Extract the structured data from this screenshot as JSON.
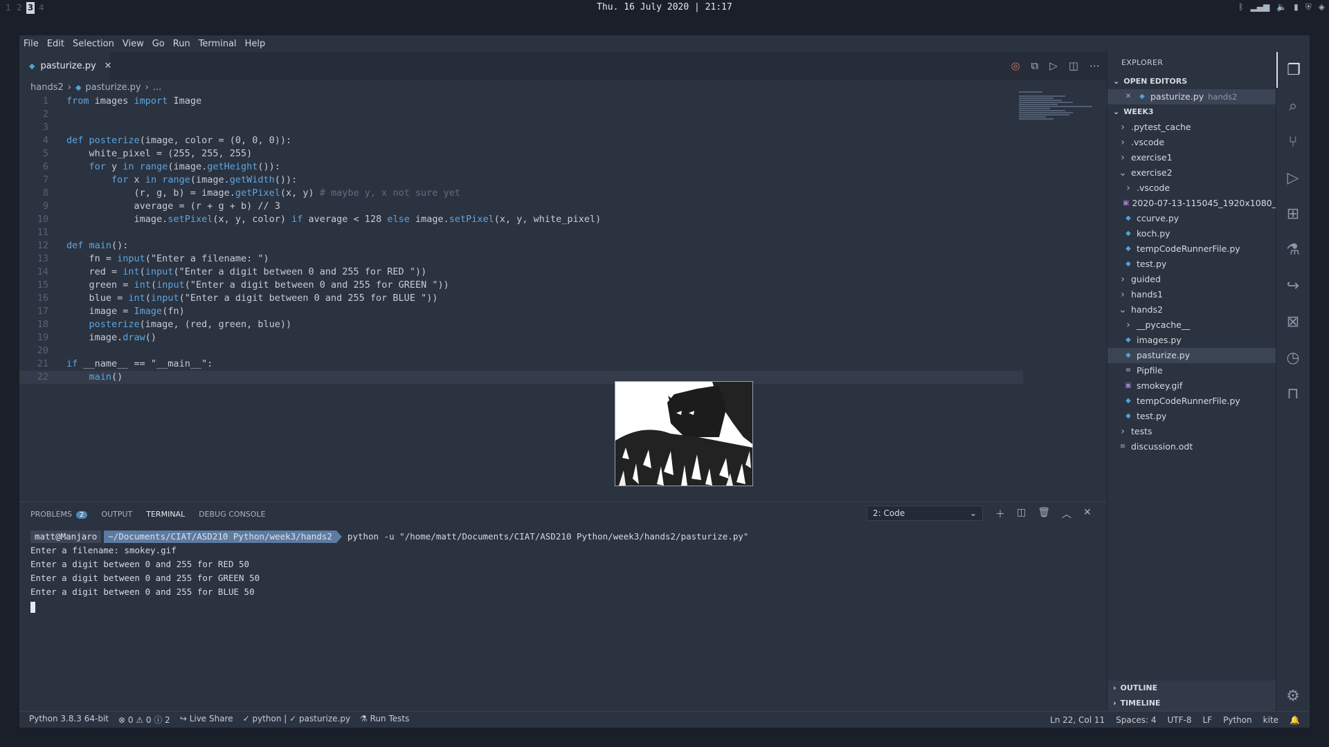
{
  "topbar": {
    "workspaces": [
      "1",
      "2",
      "3",
      "4"
    ],
    "active_workspace": "3",
    "datetime": "Thu. 16 July 2020  |  21:17"
  },
  "menu": [
    "File",
    "Edit",
    "Selection",
    "View",
    "Go",
    "Run",
    "Terminal",
    "Help"
  ],
  "editor": {
    "tab_label": "pasturize.py",
    "breadcrumb": [
      "hands2",
      "pasturize.py",
      "..."
    ],
    "lines": [
      {
        "n": "1",
        "parts": [
          [
            "kw",
            "from"
          ],
          [
            "",
            " images "
          ],
          [
            "kw",
            "import"
          ],
          [
            "",
            " Image"
          ]
        ]
      },
      {
        "n": "2",
        "parts": []
      },
      {
        "n": "3",
        "parts": []
      },
      {
        "n": "4",
        "parts": [
          [
            "kw",
            "def"
          ],
          [
            "",
            " "
          ],
          [
            "fn",
            "posterize"
          ],
          [
            "",
            "(image, color = (0, 0, 0)):"
          ]
        ]
      },
      {
        "n": "5",
        "parts": [
          [
            "",
            "    white_pixel = (255, 255, 255)"
          ]
        ]
      },
      {
        "n": "6",
        "parts": [
          [
            "",
            "    "
          ],
          [
            "kw",
            "for"
          ],
          [
            "",
            " y "
          ],
          [
            "kw",
            "in"
          ],
          [
            "",
            " "
          ],
          [
            "fn",
            "range"
          ],
          [
            "",
            "(image."
          ],
          [
            "fn",
            "getHeight"
          ],
          [
            "",
            "()):"
          ]
        ]
      },
      {
        "n": "7",
        "parts": [
          [
            "",
            "        "
          ],
          [
            "kw",
            "for"
          ],
          [
            "",
            " x "
          ],
          [
            "kw",
            "in"
          ],
          [
            "",
            " "
          ],
          [
            "fn",
            "range"
          ],
          [
            "",
            "(image."
          ],
          [
            "fn",
            "getWidth"
          ],
          [
            "",
            "()):"
          ]
        ]
      },
      {
        "n": "8",
        "parts": [
          [
            "",
            "            (r, g, b) = image."
          ],
          [
            "fn",
            "getPixel"
          ],
          [
            "",
            "(x, y) "
          ],
          [
            "cm",
            "# maybe y, x not sure yet"
          ]
        ]
      },
      {
        "n": "9",
        "parts": [
          [
            "",
            "            average = (r + g + b) // 3"
          ]
        ]
      },
      {
        "n": "10",
        "parts": [
          [
            "",
            "            image."
          ],
          [
            "fn",
            "setPixel"
          ],
          [
            "",
            "(x, y, color) "
          ],
          [
            "kw",
            "if"
          ],
          [
            "",
            " average < 128 "
          ],
          [
            "kw",
            "else"
          ],
          [
            "",
            " image."
          ],
          [
            "fn",
            "setPixel"
          ],
          [
            "",
            "(x, y, white_pixel)"
          ]
        ]
      },
      {
        "n": "11",
        "parts": []
      },
      {
        "n": "12",
        "parts": [
          [
            "kw",
            "def"
          ],
          [
            "",
            " "
          ],
          [
            "fn",
            "main"
          ],
          [
            "",
            "():"
          ]
        ]
      },
      {
        "n": "13",
        "parts": [
          [
            "",
            "    fn = "
          ],
          [
            "fn",
            "input"
          ],
          [
            "",
            "(\"Enter a filename: \")"
          ]
        ]
      },
      {
        "n": "14",
        "parts": [
          [
            "",
            "    red = "
          ],
          [
            "fn",
            "int"
          ],
          [
            "",
            "("
          ],
          [
            "fn",
            "input"
          ],
          [
            "",
            "(\"Enter a digit between 0 and 255 for RED \"))"
          ]
        ]
      },
      {
        "n": "15",
        "parts": [
          [
            "",
            "    green = "
          ],
          [
            "fn",
            "int"
          ],
          [
            "",
            "("
          ],
          [
            "fn",
            "input"
          ],
          [
            "",
            "(\"Enter a digit between 0 and 255 for GREEN \"))"
          ]
        ]
      },
      {
        "n": "16",
        "parts": [
          [
            "",
            "    blue = "
          ],
          [
            "fn",
            "int"
          ],
          [
            "",
            "("
          ],
          [
            "fn",
            "input"
          ],
          [
            "",
            "(\"Enter a digit between 0 and 255 for BLUE \"))"
          ]
        ]
      },
      {
        "n": "17",
        "parts": [
          [
            "",
            "    image = "
          ],
          [
            "fn",
            "Image"
          ],
          [
            "",
            "(fn)"
          ]
        ]
      },
      {
        "n": "18",
        "parts": [
          [
            "",
            "    "
          ],
          [
            "fn",
            "posterize"
          ],
          [
            "",
            "(image, (red, green, blue))"
          ]
        ]
      },
      {
        "n": "19",
        "parts": [
          [
            "",
            "    image."
          ],
          [
            "fn",
            "draw"
          ],
          [
            "",
            "()"
          ]
        ]
      },
      {
        "n": "20",
        "parts": []
      },
      {
        "n": "21",
        "parts": [
          [
            "kw",
            "if"
          ],
          [
            "",
            " __name__ == \"__main__\":"
          ]
        ]
      },
      {
        "n": "22",
        "parts": [
          [
            "",
            "    "
          ],
          [
            "fn",
            "main"
          ],
          [
            "",
            "()"
          ]
        ],
        "current": true
      }
    ]
  },
  "explorer": {
    "title": "EXPLORER",
    "open_editors_label": "OPEN EDITORS",
    "open_editor": {
      "name": "pasturize.py",
      "folder": "hands2"
    },
    "root_label": "WEEK3",
    "tree": [
      {
        "name": ".pytest_cache",
        "type": "folder",
        "depth": 1,
        "open": false
      },
      {
        "name": ".vscode",
        "type": "folder",
        "depth": 1,
        "open": false
      },
      {
        "name": "exercise1",
        "type": "folder",
        "depth": 1,
        "open": false
      },
      {
        "name": "exercise2",
        "type": "folder",
        "depth": 1,
        "open": true
      },
      {
        "name": ".vscode",
        "type": "folder",
        "depth": 2,
        "open": false
      },
      {
        "name": "2020-07-13-115045_1920x1080_...",
        "type": "image",
        "depth": 2
      },
      {
        "name": "ccurve.py",
        "type": "py",
        "depth": 2
      },
      {
        "name": "koch.py",
        "type": "py",
        "depth": 2
      },
      {
        "name": "tempCodeRunnerFile.py",
        "type": "py",
        "depth": 2
      },
      {
        "name": "test.py",
        "type": "py",
        "depth": 2
      },
      {
        "name": "guided",
        "type": "folder",
        "depth": 1,
        "open": false
      },
      {
        "name": "hands1",
        "type": "folder",
        "depth": 1,
        "open": false
      },
      {
        "name": "hands2",
        "type": "folder",
        "depth": 1,
        "open": true
      },
      {
        "name": "__pycache__",
        "type": "folder",
        "depth": 2,
        "open": false
      },
      {
        "name": "images.py",
        "type": "py",
        "depth": 2
      },
      {
        "name": "pasturize.py",
        "type": "py",
        "depth": 2,
        "selected": true
      },
      {
        "name": "Pipfile",
        "type": "text",
        "depth": 2
      },
      {
        "name": "smokey.gif",
        "type": "image",
        "depth": 2
      },
      {
        "name": "tempCodeRunnerFile.py",
        "type": "py",
        "depth": 2
      },
      {
        "name": "test.py",
        "type": "py",
        "depth": 2
      },
      {
        "name": "tests",
        "type": "folder",
        "depth": 1,
        "open": false
      },
      {
        "name": "discussion.odt",
        "type": "text",
        "depth": 1
      }
    ],
    "outline_label": "OUTLINE",
    "timeline_label": "TIMELINE"
  },
  "panel": {
    "tabs": {
      "problems": "PROBLEMS",
      "problems_count": "2",
      "output": "OUTPUT",
      "terminal": "TERMINAL",
      "debug": "DEBUG CONSOLE"
    },
    "terminal_select": "2: Code",
    "prompt_user": "matt@Manjaro",
    "prompt_path": "~/Documents/CIAT/ASD210 Python/week3/hands2",
    "command": "python -u \"/home/matt/Documents/CIAT/ASD210 Python/week3/hands2/pasturize.py\"",
    "output_lines": [
      "Enter a filename: smokey.gif",
      "Enter a digit between 0 and 255 for RED 50",
      "Enter a digit between 0 and 255 for GREEN 50",
      "Enter a digit between 0 and 255 for BLUE 50"
    ]
  },
  "statusbar": {
    "python": "Python 3.8.3 64-bit",
    "problems": "⊗ 0 ⚠ 0 ⓘ 2",
    "liveshare": "Live Share",
    "checks": "✓ python | ✓ pasturize.py",
    "runtests": "Run Tests",
    "position": "Ln 22, Col 11",
    "spaces": "Spaces: 4",
    "encoding": "UTF-8",
    "eol": "LF",
    "language": "Python",
    "kite": "kite"
  }
}
